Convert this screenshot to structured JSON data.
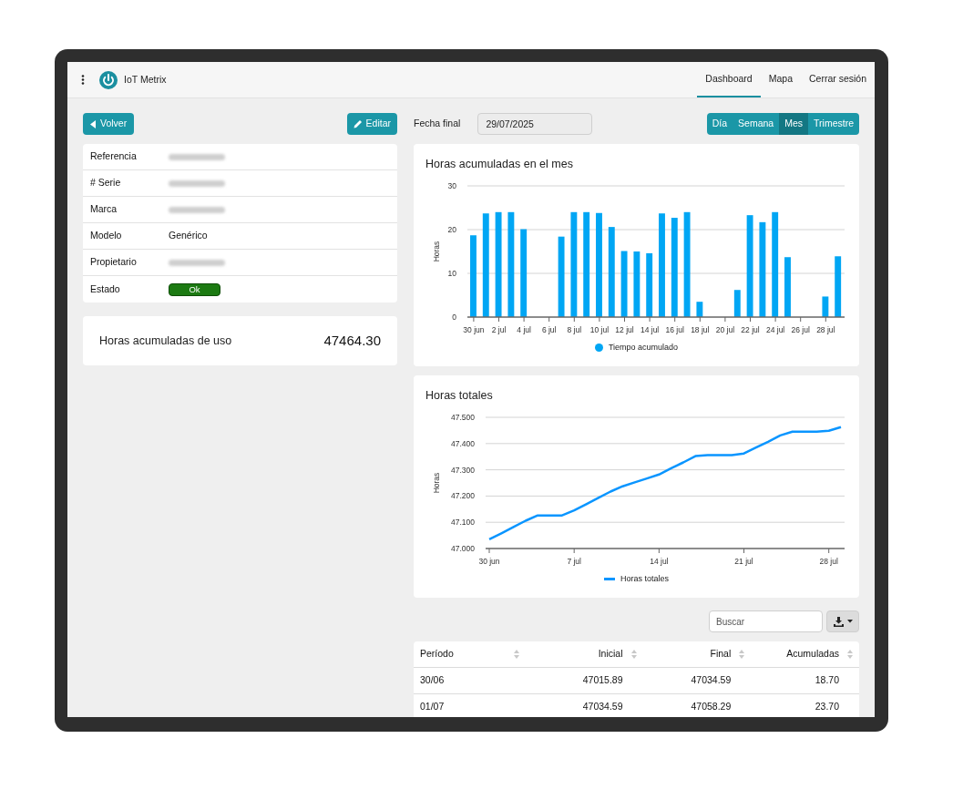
{
  "nav": {
    "brand": "IoT Metrix",
    "links": [
      {
        "label": "Dashboard",
        "selected": true
      },
      {
        "label": "Mapa",
        "selected": false
      },
      {
        "label": "Cerrar sesión",
        "selected": false
      }
    ]
  },
  "toolbar": {
    "back": "Volver",
    "edit": "Editar",
    "date_label": "Fecha final",
    "date_value": "29/07/2025",
    "periods": [
      {
        "label": "Día",
        "selected": false
      },
      {
        "label": "Semana",
        "selected": false
      },
      {
        "label": "Mes",
        "selected": true
      },
      {
        "label": "Trimestre",
        "selected": false
      }
    ]
  },
  "device": {
    "rows": [
      {
        "label": "Referencia",
        "kind": "redacted"
      },
      {
        "label": "# Serie",
        "kind": "redacted"
      },
      {
        "label": "Marca",
        "kind": "redacted"
      },
      {
        "label": "Modelo",
        "kind": "text",
        "value": "Genérico"
      },
      {
        "label": "Propietario",
        "kind": "redacted"
      },
      {
        "label": "Estado",
        "kind": "status",
        "value": "Ok"
      }
    ]
  },
  "usage": {
    "label": "Horas acumuladas de uso",
    "value": "47464.30"
  },
  "monthly_chart": {
    "title": "Horas acumuladas en el mes",
    "chart_data": {
      "type": "bar",
      "grid": true,
      "ylabel": "Horas",
      "ylim": [
        0,
        30
      ],
      "yticks": [
        0,
        10,
        20,
        30
      ],
      "categories": [
        "30 jun",
        null,
        "2 jul",
        null,
        "4 jul",
        null,
        "6 jul",
        null,
        "8 jul",
        null,
        "10 jul",
        null,
        "12 jul",
        null,
        "14 jul",
        null,
        "16 jul",
        null,
        "18 jul",
        null,
        "20 jul",
        null,
        "22 jul",
        null,
        "24 jul",
        null,
        "26 jul",
        null,
        "28 jul",
        null
      ],
      "series": [
        {
          "name": "Tiempo acumulado",
          "color": "#00a6f4",
          "values": [
            18.7,
            23.7,
            24,
            24,
            20.1,
            0,
            0,
            18.4,
            24,
            24,
            23.8,
            20.6,
            15.1,
            15,
            14.6,
            23.7,
            22.7,
            24,
            3.5,
            0,
            0,
            6.2,
            23.3,
            21.7,
            24,
            13.7,
            0,
            0,
            4.7,
            13.9
          ]
        }
      ]
    }
  },
  "total_chart": {
    "title": "Horas totales",
    "chart_data": {
      "type": "line",
      "grid": true,
      "ylabel": "Horas",
      "ylim": [
        47,
        47.5
      ],
      "yticks": [
        {
          "value": 47,
          "label": "47.000"
        },
        {
          "value": 47.1,
          "label": "47.100"
        },
        {
          "value": 47.2,
          "label": "47.200"
        },
        {
          "value": 47.3,
          "label": "47.300"
        },
        {
          "value": 47.4,
          "label": "47.400"
        },
        {
          "value": 47.5,
          "label": "47.500"
        }
      ],
      "categories": [
        "30 jun",
        null,
        null,
        null,
        null,
        null,
        null,
        "7 jul",
        null,
        null,
        null,
        null,
        null,
        null,
        "14 jul",
        null,
        null,
        null,
        null,
        null,
        null,
        "21 jul",
        null,
        null,
        null,
        null,
        null,
        null,
        "28 jul",
        null
      ],
      "series": [
        {
          "name": "Horas totales",
          "color": "#0a95ff",
          "values": [
            47.035,
            47.058,
            47.082,
            47.106,
            47.126,
            47.126,
            47.126,
            47.145,
            47.169,
            47.193,
            47.217,
            47.237,
            47.252,
            47.267,
            47.282,
            47.306,
            47.328,
            47.352,
            47.356,
            47.356,
            47.356,
            47.362,
            47.385,
            47.407,
            47.431,
            47.445,
            47.445,
            47.445,
            47.449,
            47.463
          ]
        }
      ]
    }
  },
  "table": {
    "search_placeholder": "Buscar",
    "columns": [
      "Período",
      "Inicial",
      "Final",
      "Acumuladas"
    ],
    "rows": [
      [
        "30/06",
        "47015.89",
        "47034.59",
        "18.70"
      ],
      [
        "01/07",
        "47034.59",
        "47058.29",
        "23.70"
      ]
    ]
  }
}
